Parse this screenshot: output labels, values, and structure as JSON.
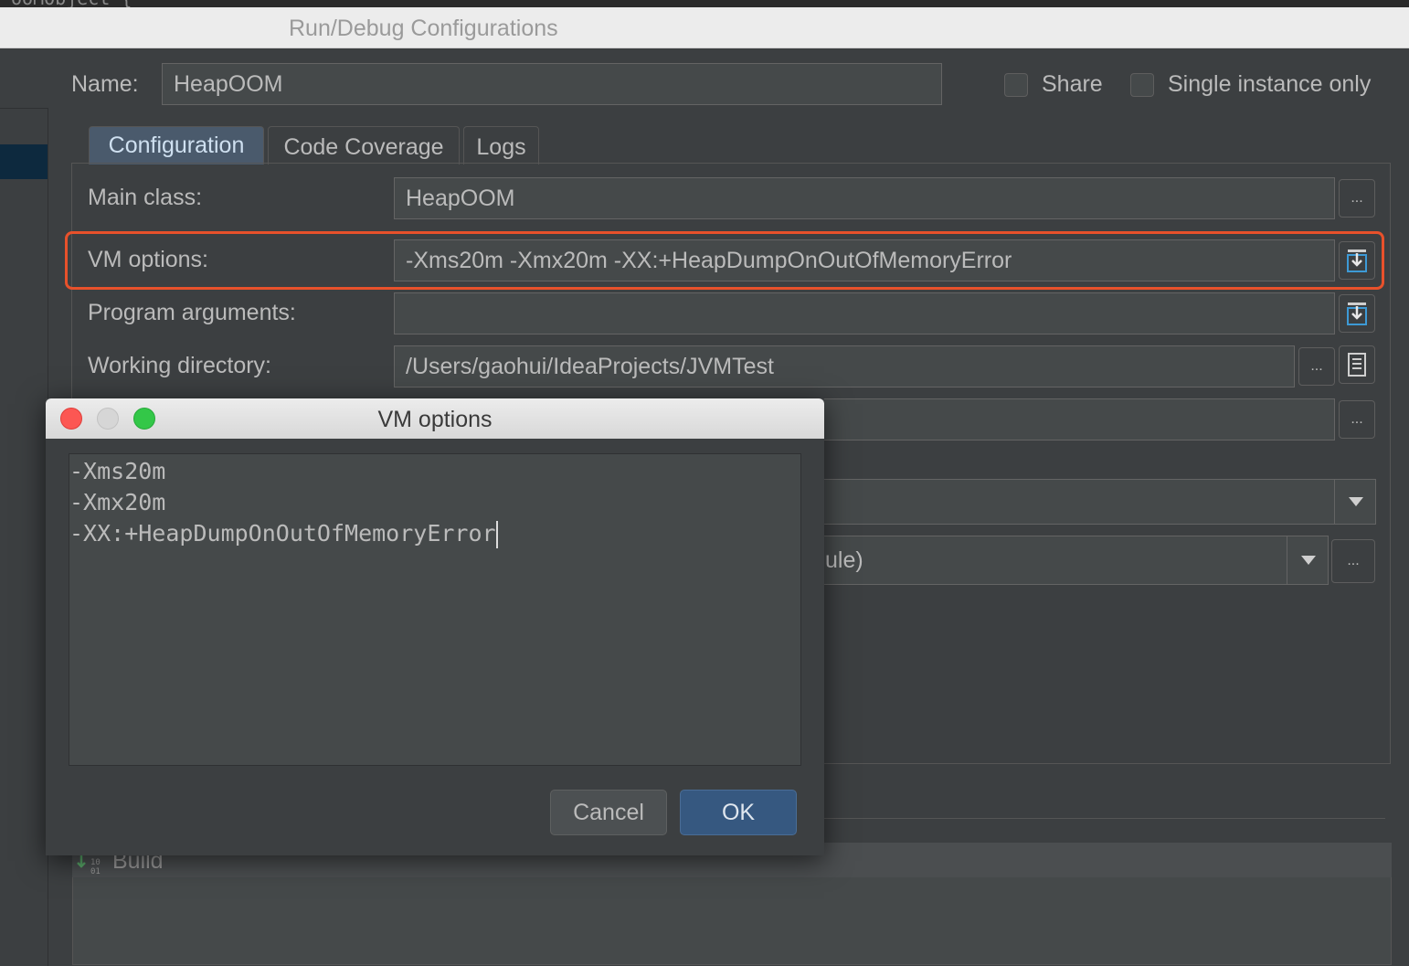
{
  "top_code_fragment": "ooMObject {",
  "window": {
    "title": "Run/Debug Configurations"
  },
  "name_row": {
    "label": "Name:",
    "value": "HeapOOM",
    "share_label": "Share",
    "single_instance_label": "Single instance only"
  },
  "tabs": [
    {
      "label": "Configuration",
      "active": true
    },
    {
      "label": "Code Coverage",
      "active": false
    },
    {
      "label": "Logs",
      "active": false
    }
  ],
  "form": {
    "main_class": {
      "label": "Main class:",
      "value": "HeapOOM"
    },
    "vm_options": {
      "label": "VM options:",
      "value": "-Xms20m -Xmx20m -XX:+HeapDumpOnOutOfMemoryError"
    },
    "program_arguments": {
      "label": "Program arguments:",
      "value": ""
    },
    "working_directory": {
      "label": "Working directory:",
      "value": "/Users/gaohui/IdeaProjects/JVMTest"
    },
    "module_fragment": "ule)",
    "ellipsis": "..."
  },
  "build_label": "Build",
  "dialog": {
    "title": "VM options",
    "lines": [
      "-Xms20m",
      "-Xmx20m",
      "-XX:+HeapDumpOnOutOfMemoryError"
    ],
    "cancel_label": "Cancel",
    "ok_label": "OK"
  },
  "colors": {
    "highlight": "#e8512b",
    "active_tab": "#4a5a6c",
    "ok_button": "#365880",
    "background": "#3c3f41"
  },
  "icons": [
    "expand-editor-icon",
    "folder-icon",
    "dropdown-arrow-icon",
    "close-light",
    "minimize-light",
    "zoom-light",
    "build-icon"
  ]
}
